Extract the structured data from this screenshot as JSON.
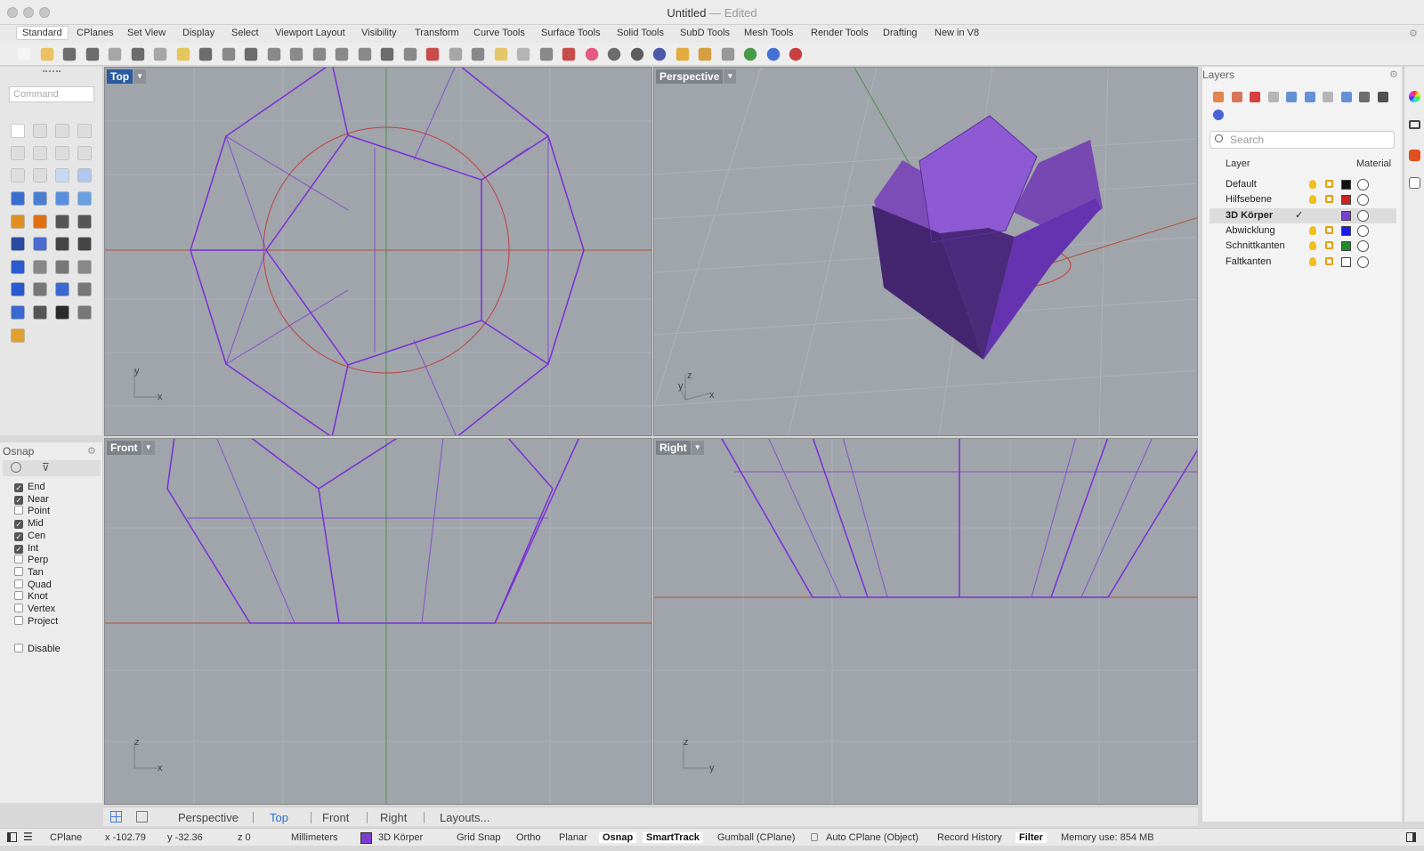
{
  "window": {
    "title": "Untitled",
    "subtitle": "— Edited"
  },
  "tabs": [
    "Standard",
    "CPlanes",
    "Set View",
    "Display",
    "Select",
    "Viewport Layout",
    "Visibility",
    "Transform",
    "Curve Tools",
    "Surface Tools",
    "Solid Tools",
    "SubD Tools",
    "Mesh Tools",
    "Render Tools",
    "Drafting",
    "New in V8"
  ],
  "command": {
    "placeholder": "Command"
  },
  "osnap": {
    "title": "Osnap",
    "items": [
      {
        "label": "End",
        "checked": true
      },
      {
        "label": "Near",
        "checked": true
      },
      {
        "label": "Point",
        "checked": false
      },
      {
        "label": "Mid",
        "checked": true
      },
      {
        "label": "Cen",
        "checked": true
      },
      {
        "label": "Int",
        "checked": true
      },
      {
        "label": "Perp",
        "checked": false
      },
      {
        "label": "Tan",
        "checked": false
      },
      {
        "label": "Quad",
        "checked": false
      },
      {
        "label": "Knot",
        "checked": false
      },
      {
        "label": "Vertex",
        "checked": false
      },
      {
        "label": "Project",
        "checked": false
      }
    ],
    "disable": {
      "label": "Disable",
      "checked": false
    }
  },
  "viewports": {
    "top": {
      "name": "Top",
      "axis_a": "y",
      "axis_b": "x"
    },
    "perspective": {
      "name": "Perspective",
      "axis_a": "z",
      "axis_b": "y",
      "axis_c": "x"
    },
    "front": {
      "name": "Front",
      "axis_a": "z",
      "axis_b": "x"
    },
    "right": {
      "name": "Right",
      "axis_a": "z",
      "axis_b": "y"
    }
  },
  "viewport_tabs": {
    "items": [
      "Perspective",
      "Top",
      "Front",
      "Right",
      "Layouts..."
    ],
    "active": "Top"
  },
  "status": {
    "cplane": "CPlane",
    "x": "x -102.79",
    "y": "y -32.36",
    "z": "z 0",
    "units": "Millimeters",
    "layer": "3D Körper",
    "grid_snap": "Grid Snap",
    "ortho": "Ortho",
    "planar": "Planar",
    "osnap": "Osnap",
    "smarttrack": "SmartTrack",
    "gumball": "Gumball (CPlane)",
    "autocplane": "Auto CPlane (Object)",
    "record": "Record History",
    "filter": "Filter",
    "memory": "Memory use: 854 MB"
  },
  "layers": {
    "title": "Layers",
    "search_placeholder": "Search",
    "col_layer": "Layer",
    "col_material": "Material",
    "rows": [
      {
        "name": "Default",
        "color": "#111111",
        "current": false
      },
      {
        "name": "Hilfsebene",
        "color": "#cc2222",
        "current": false
      },
      {
        "name": "3D Körper",
        "color": "#7a3fd0",
        "current": true
      },
      {
        "name": "Abwicklung",
        "color": "#1a1aee",
        "current": false
      },
      {
        "name": "Schnittkanten",
        "color": "#1f8a2a",
        "current": false
      },
      {
        "name": "Faltkanten",
        "color": "#ffffff",
        "current": false
      }
    ],
    "check": "✓"
  },
  "colors": {
    "accent": "#2a5aa0",
    "object": "#7a2fd6",
    "viewport_bg": "#a0a4ab"
  }
}
